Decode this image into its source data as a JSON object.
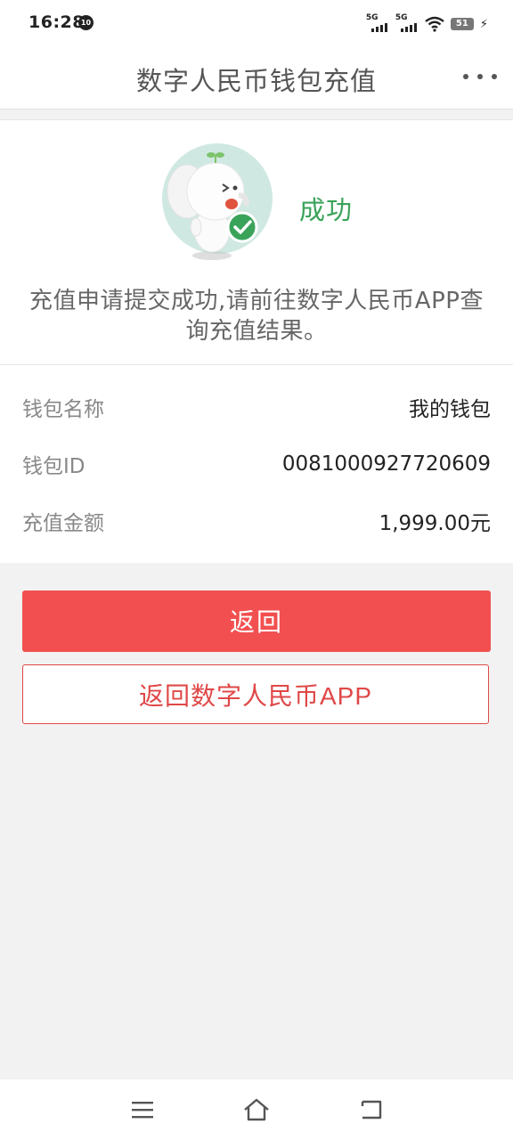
{
  "status_bar": {
    "time": "16:28",
    "notification_badge": "10",
    "signal1_label": "5G",
    "signal2_label": "5G",
    "battery_level": "51"
  },
  "header": {
    "title": "数字人民币钱包充值",
    "more_icon": "more-dots-icon"
  },
  "result": {
    "status_text": "成功",
    "message": "充值申请提交成功,请前往数字人民币APP查询充值结果。",
    "icon": "elephant-mascot-check-icon",
    "status_color": "#3aa35a"
  },
  "details": [
    {
      "label": "钱包名称",
      "value": "我的钱包"
    },
    {
      "label": "钱包ID",
      "value": "0081000927720609"
    },
    {
      "label": "充值金额",
      "value": "1,999.00元"
    }
  ],
  "actions": {
    "back_label": "返回",
    "back_to_app_label": "返回数字人民币APP",
    "accent_color": "#f25050"
  },
  "nav": {
    "menu_icon": "menu-icon",
    "home_icon": "home-icon",
    "back_icon": "back-icon"
  }
}
